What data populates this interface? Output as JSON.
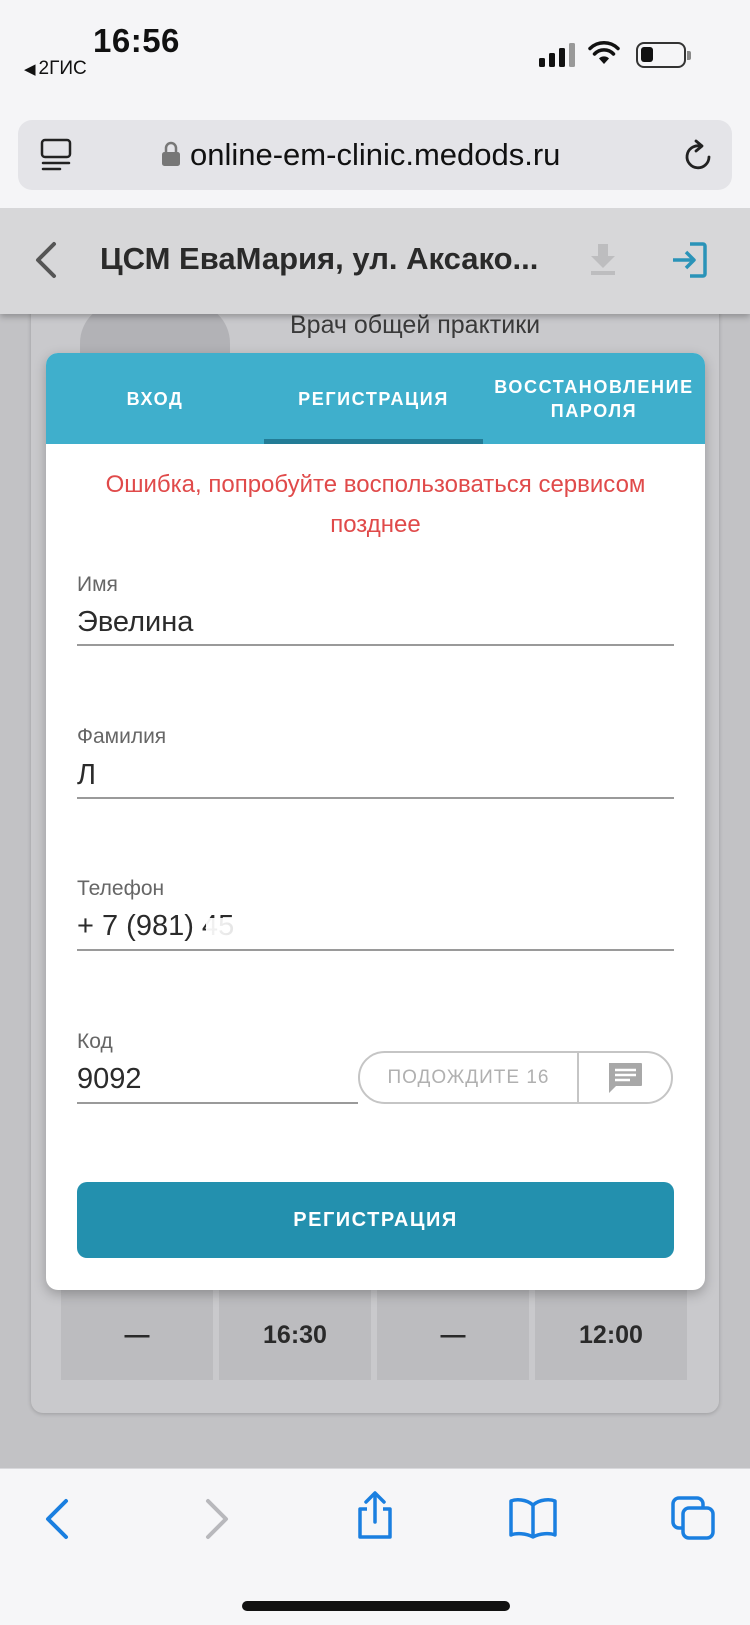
{
  "status_bar": {
    "time": "16:56",
    "back_app": "2ГИС"
  },
  "browser": {
    "url": "online-em-clinic.medods.ru"
  },
  "app_header": {
    "title": "ЦСМ ЕваМария, ул. Аксако..."
  },
  "background": {
    "doctor_specialty": "Врач общей практики",
    "slots": [
      "—",
      "16:30",
      "—",
      "12:00"
    ]
  },
  "modal": {
    "tabs": [
      {
        "label": "ВХОД",
        "active": false
      },
      {
        "label": "РЕГИСТРАЦИЯ",
        "active": true
      },
      {
        "label": "ВОССТАНОВЛЕНИЕ ПАРОЛЯ",
        "active": false
      }
    ],
    "error_message": "Ошибка, попробуйте воспользоваться сервисом позднее",
    "fields": {
      "first_name": {
        "label": "Имя",
        "value": "Эвелина"
      },
      "last_name": {
        "label": "Фамилия",
        "value": "Л"
      },
      "phone": {
        "label": "Телефон",
        "value": "+ 7 (981) 45"
      },
      "code": {
        "label": "Код",
        "value": "9092"
      }
    },
    "wait_button": "ПОДОЖДИТЕ 16",
    "register_button": "РЕГИСТРАЦИЯ"
  },
  "colors": {
    "tab_bar": "#3fafcc",
    "active_tab_indicator": "#237c96",
    "error": "#e04a4a",
    "primary_button": "#2390ae",
    "ios_blue": "#1a7fe0"
  }
}
